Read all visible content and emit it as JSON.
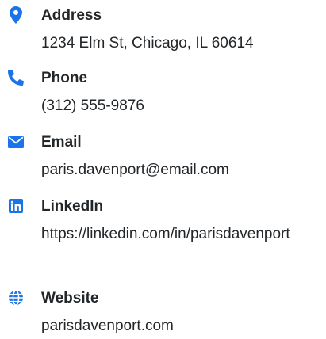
{
  "accent_color": "#1a73e8",
  "contacts": [
    {
      "icon": "map-pin-icon",
      "label": "Address",
      "value": "1234 Elm St, Chicago, IL 60614"
    },
    {
      "icon": "phone-icon",
      "label": "Phone",
      "value": "(312) 555-9876"
    },
    {
      "icon": "envelope-icon",
      "label": "Email",
      "value": "paris.davenport@email.com"
    },
    {
      "icon": "linkedin-icon",
      "label": "LinkedIn",
      "value": "https://linkedin.com/in/parisdavenport"
    },
    {
      "icon": "globe-icon",
      "label": "Website",
      "value": "parisdavenport.com"
    }
  ]
}
